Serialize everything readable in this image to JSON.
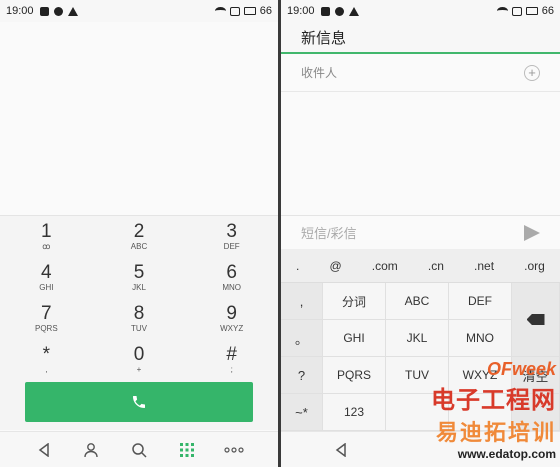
{
  "status": {
    "time": "19:00",
    "battery": "66"
  },
  "dialer": {
    "keys": [
      [
        {
          "digit": "1",
          "letters": "ꝏ"
        },
        {
          "digit": "2",
          "letters": "ABC"
        },
        {
          "digit": "3",
          "letters": "DEF"
        }
      ],
      [
        {
          "digit": "4",
          "letters": "GHI"
        },
        {
          "digit": "5",
          "letters": "JKL"
        },
        {
          "digit": "6",
          "letters": "MNO"
        }
      ],
      [
        {
          "digit": "7",
          "letters": "PQRS"
        },
        {
          "digit": "8",
          "letters": "TUV"
        },
        {
          "digit": "9",
          "letters": "WXYZ"
        }
      ],
      [
        {
          "digit": "*",
          "letters": ","
        },
        {
          "digit": "0",
          "letters": "+"
        },
        {
          "digit": "#",
          "letters": ";"
        }
      ]
    ],
    "call_icon": "phone-icon",
    "nav": [
      "back-icon",
      "contacts-icon",
      "search-icon",
      "dialpad-icon",
      "more-icon"
    ],
    "accent": "#35b56a"
  },
  "message": {
    "title": "新信息",
    "recipient_label": "收件人",
    "compose_placeholder": "短信/彩信",
    "symbols": [
      ".",
      "@",
      ".com",
      ".cn",
      ".net",
      ".org"
    ],
    "side_keys": [
      ",",
      "。",
      "?",
      "!"
    ],
    "keys": [
      [
        "分词",
        "ABC",
        "DEF"
      ],
      [
        "GHI",
        "JKL",
        "MNO"
      ],
      [
        "PQRS",
        "TUV",
        "WXYZ"
      ]
    ],
    "clear_label": "清空",
    "bottom_left": "~*",
    "bottom_123": "123",
    "watermark": {
      "brand": "OFweek",
      "cn": "电子工程网",
      "cn2": "易迪拓培训",
      "url": "www.edatop.com"
    }
  }
}
